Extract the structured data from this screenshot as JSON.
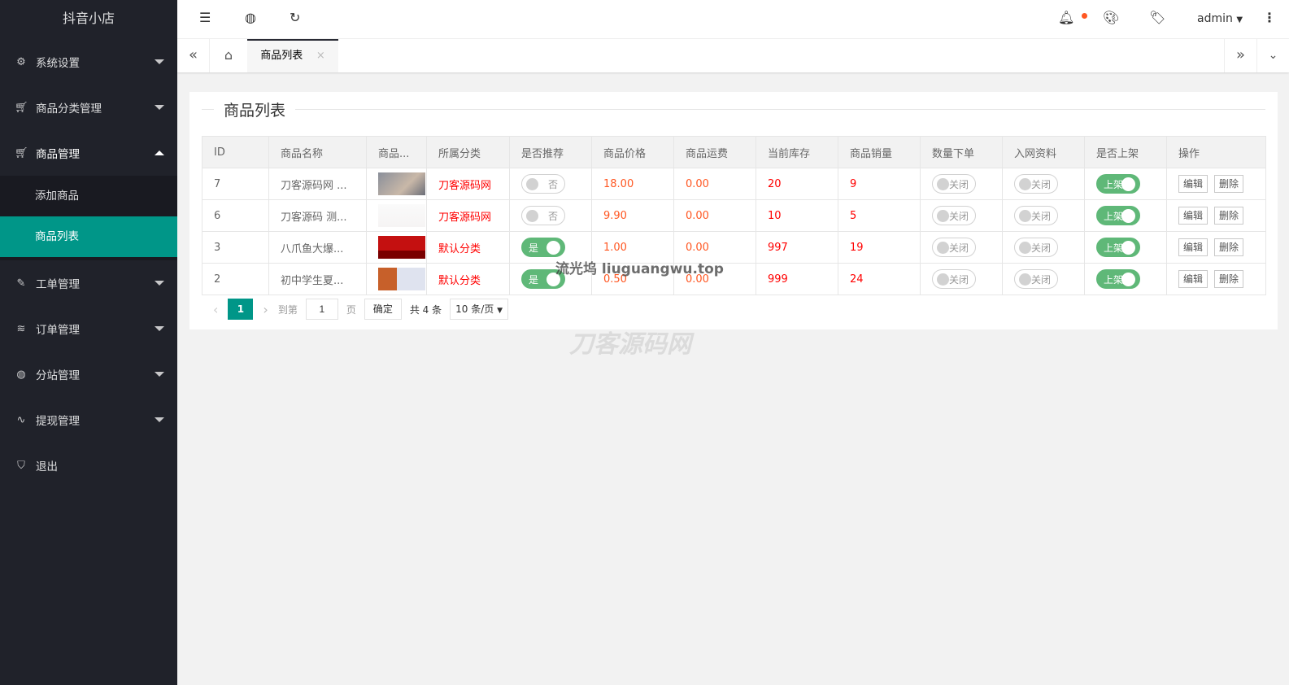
{
  "sidebar": {
    "logo": "抖音小店",
    "items": [
      {
        "label": "系统设置",
        "icon": "gear-icon"
      },
      {
        "label": "商品分类管理",
        "icon": "cart-icon"
      },
      {
        "label": "商品管理",
        "icon": "cart-icon",
        "children": [
          "添加商品",
          "商品列表"
        ],
        "active_child": "商品列表"
      },
      {
        "label": "工单管理",
        "icon": "ticket-icon"
      },
      {
        "label": "订单管理",
        "icon": "layers-icon"
      },
      {
        "label": "分站管理",
        "icon": "globe-icon"
      },
      {
        "label": "提现管理",
        "icon": "pulse-icon"
      },
      {
        "label": "退出",
        "icon": "shield-icon"
      }
    ]
  },
  "header": {
    "user": "admin",
    "notification_dot_color": "#ff5722"
  },
  "tabs": [
    {
      "label": "商品列表",
      "close": "×"
    }
  ],
  "card": {
    "title": "商品列表"
  },
  "table": {
    "columns": [
      "ID",
      "商品名称",
      "商品...",
      "所属分类",
      "是否推荐",
      "商品价格",
      "商品运费",
      "当前库存",
      "商品销量",
      "数量下单",
      "入网资料",
      "是否上架",
      "操作"
    ],
    "rows": [
      {
        "id": "7",
        "name": "刀客源码网 ...",
        "category": "刀客源码网",
        "recommend": "否",
        "recommend_on": false,
        "price": "18.00",
        "shipping": "0.00",
        "stock": "20",
        "sales": "9",
        "qty_order": "关闭",
        "netinfo": "关闭",
        "listed": "上架"
      },
      {
        "id": "6",
        "name": "刀客源码 测...",
        "category": "刀客源码网",
        "recommend": "否",
        "recommend_on": false,
        "price": "9.90",
        "shipping": "0.00",
        "stock": "10",
        "sales": "5",
        "qty_order": "关闭",
        "netinfo": "关闭",
        "listed": "上架"
      },
      {
        "id": "3",
        "name": "八爪鱼大爆...",
        "category": "默认分类",
        "recommend": "是",
        "recommend_on": true,
        "price": "1.00",
        "shipping": "0.00",
        "stock": "997",
        "sales": "19",
        "qty_order": "关闭",
        "netinfo": "关闭",
        "listed": "上架"
      },
      {
        "id": "2",
        "name": "初中学生夏...",
        "category": "默认分类",
        "recommend": "是",
        "recommend_on": true,
        "price": "0.50",
        "shipping": "0.00",
        "stock": "999",
        "sales": "24",
        "qty_order": "关闭",
        "netinfo": "关闭",
        "listed": "上架"
      }
    ],
    "edit_label": "编辑",
    "delete_label": "删除"
  },
  "pagination": {
    "current": "1",
    "goto_label": "到第",
    "goto_value": "1",
    "page_label": "页",
    "confirm": "确定",
    "total": "共 4 条",
    "page_size": "10 条/页"
  },
  "watermarks": [
    "流光坞 liuguangwu.top",
    "刀客源码网"
  ]
}
